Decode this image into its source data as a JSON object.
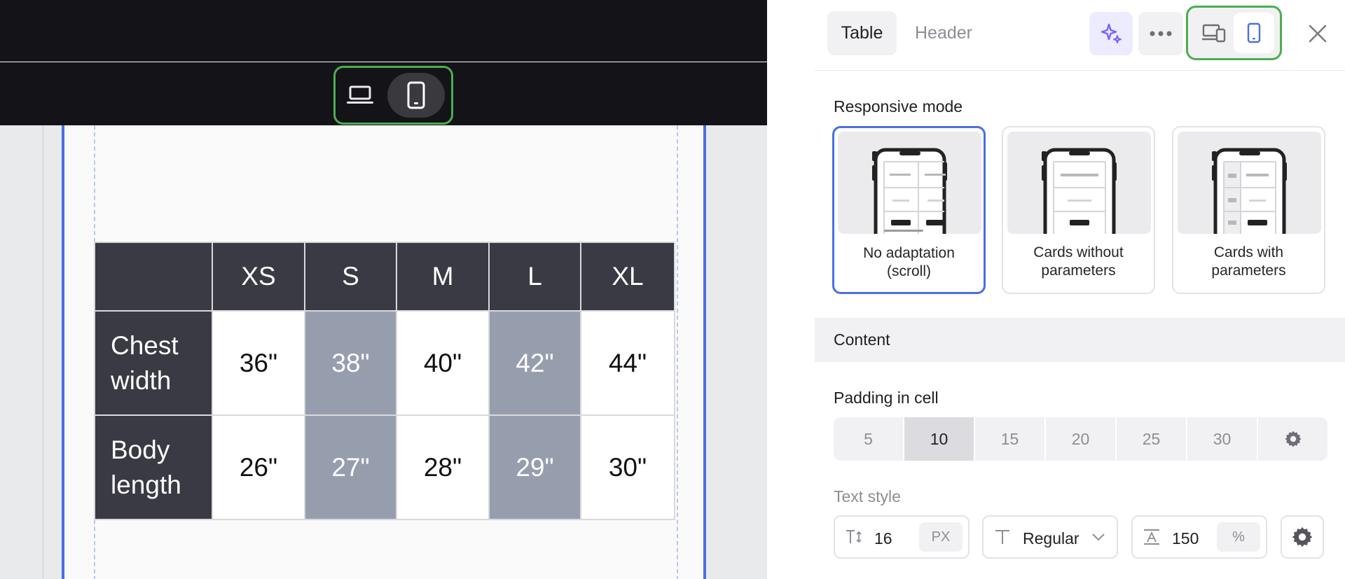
{
  "canvas": {
    "size_table": {
      "headers": [
        "",
        "XS",
        "S",
        "M",
        "L",
        "XL"
      ],
      "rows": [
        {
          "label_line1": "Chest",
          "label_line2": "width",
          "values": [
            "36\"",
            "38\"",
            "40\"",
            "42\"",
            "44\""
          ]
        },
        {
          "label_line1": "Body",
          "label_line2": "length",
          "values": [
            "26\"",
            "27\"",
            "28\"",
            "29\"",
            "30\""
          ]
        }
      ],
      "colors": {
        "header_bg": "#3a3a44",
        "shaded_bg": "#969eae",
        "cell_bg": "#ffffff"
      }
    },
    "device_switch": {
      "options": [
        "laptop-icon",
        "phone-icon"
      ],
      "selected": "phone"
    }
  },
  "panel": {
    "tabs": [
      {
        "label": "Table",
        "active": true
      },
      {
        "label": "Header",
        "active": false
      }
    ],
    "responsive_mode": {
      "label": "Responsive mode",
      "options": [
        {
          "line1": "No adaptation",
          "line2": "(scroll)",
          "selected": true
        },
        {
          "line1": "Cards without",
          "line2": "parameters",
          "selected": false
        },
        {
          "line1": "Cards with",
          "line2": "parameters",
          "selected": false
        }
      ]
    },
    "content": {
      "label": "Content"
    },
    "padding": {
      "label": "Padding in cell",
      "options": [
        "5",
        "10",
        "15",
        "20",
        "25",
        "30"
      ],
      "selected": "10"
    },
    "text_style": {
      "label": "Text style",
      "font_size": "16",
      "font_size_unit": "PX",
      "weight": "Regular",
      "line_height": "150",
      "line_height_unit": "%"
    },
    "colors": {
      "accent": "#4a6fe3",
      "highlight": "#4cae4f",
      "ai": "#7b61ff"
    }
  }
}
